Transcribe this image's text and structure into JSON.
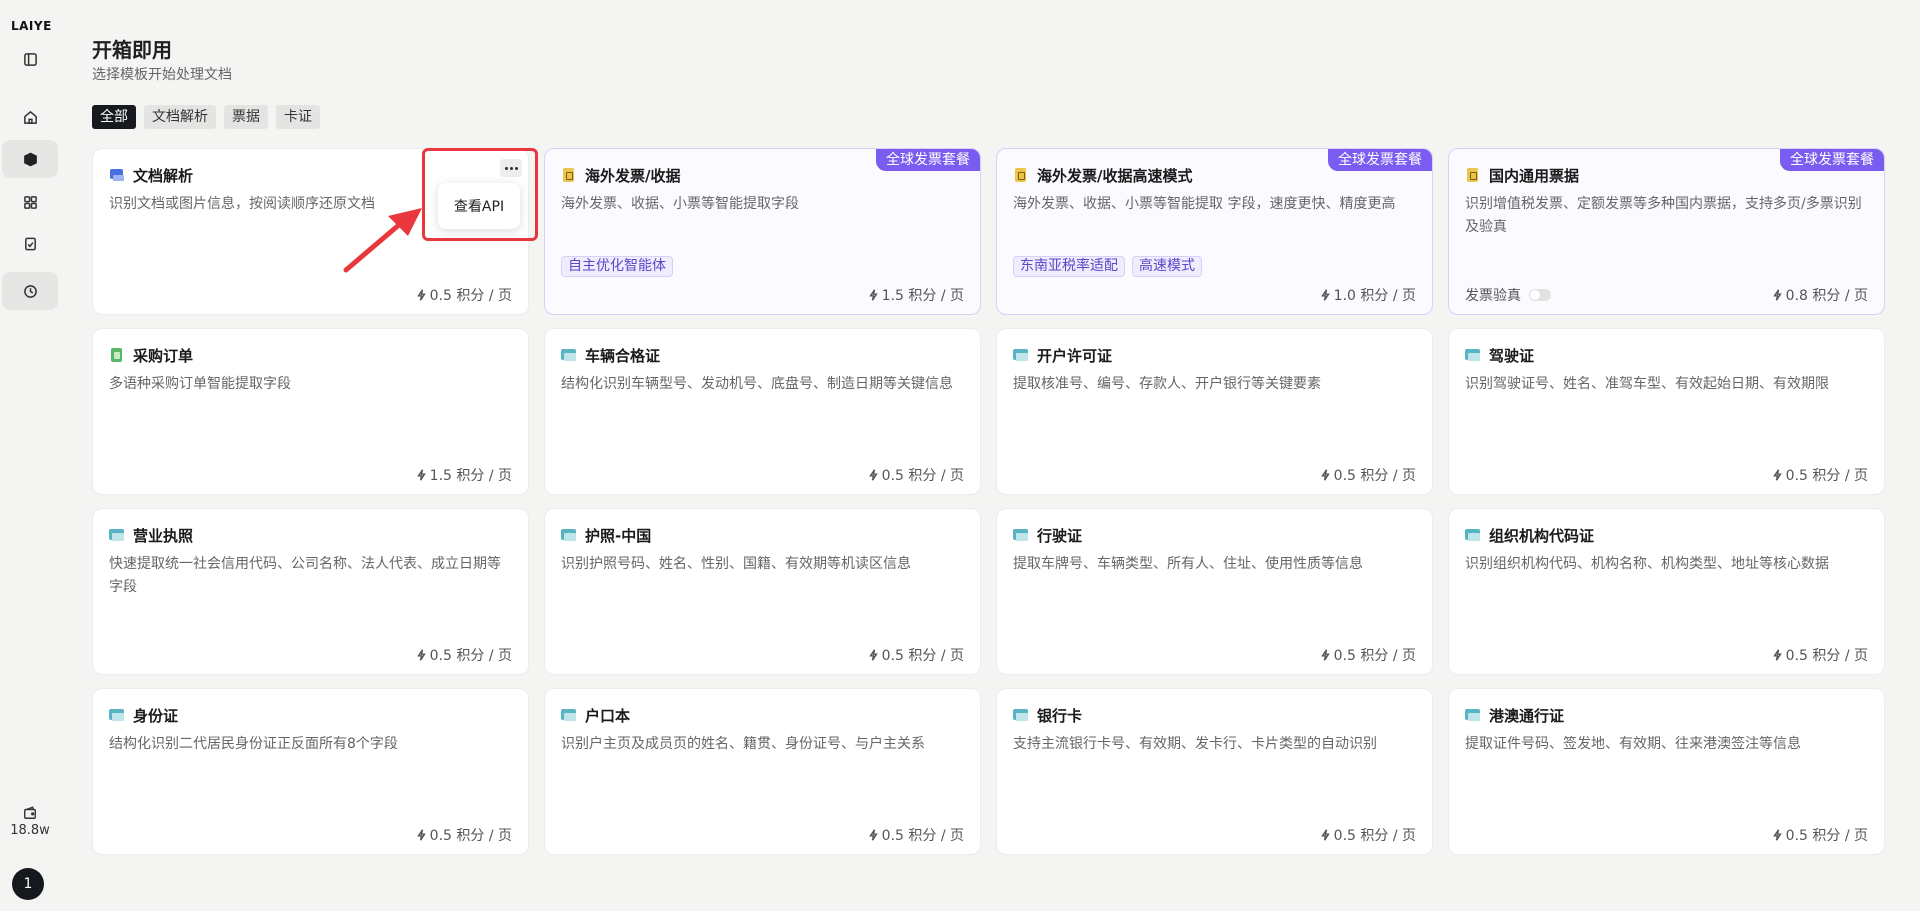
{
  "sidebar": {
    "logo": "LAIYE",
    "credits": "18.8w",
    "avatar": "1",
    "items": [
      {
        "name": "toggle-sidebar-icon"
      },
      {
        "name": "home-icon"
      },
      {
        "name": "box-icon"
      },
      {
        "name": "apps-icon"
      },
      {
        "name": "clipboard-check-icon"
      },
      {
        "name": "clock-icon"
      }
    ]
  },
  "header": {
    "title": "开箱即用",
    "subtitle": "选择模板开始处理文档"
  },
  "filters": [
    "全部",
    "文档解析",
    "票据",
    "卡证"
  ],
  "popup": {
    "label": "查看API"
  },
  "cards": [
    {
      "title": "文档解析",
      "desc": "识别文档或图片信息，按阅读顺序还原文档",
      "price": "0.5 积分 / 页",
      "icon": "doc"
    },
    {
      "title": "海外发票/收据",
      "desc": "海外发票、收据、小票等智能提取字段",
      "price": "1.5 积分 / 页",
      "icon": "inv",
      "badge": "全球发票套餐",
      "tags": [
        "自主优化智能体"
      ]
    },
    {
      "title": "海外发票/收据高速模式",
      "desc": "海外发票、收据、小票等智能提取 字段，速度更快、精度更高",
      "price": "1.0 积分 / 页",
      "icon": "inv",
      "badge": "全球发票套餐",
      "tags": [
        "东南亚税率适配",
        "高速模式"
      ]
    },
    {
      "title": "国内通用票据",
      "desc": "识别增值税发票、定额发票等多种国内票据，支持多页/多票识别及验真",
      "price": "0.8 积分 / 页",
      "icon": "inv",
      "badge": "全球发票套餐",
      "toggle": "发票验真"
    },
    {
      "title": "采购订单",
      "desc": "多语种采购订单智能提取字段",
      "price": "1.5 积分 / 页",
      "icon": "po"
    },
    {
      "title": "车辆合格证",
      "desc": "结构化识别车辆型号、发动机号、底盘号、制造日期等关键信息",
      "price": "0.5 积分 / 页",
      "icon": "card"
    },
    {
      "title": "开户许可证",
      "desc": "提取核准号、编号、存款人、开户银行等关键要素",
      "price": "0.5 积分 / 页",
      "icon": "card"
    },
    {
      "title": "驾驶证",
      "desc": "识别驾驶证号、姓名、准驾车型、有效起始日期、有效期限",
      "price": "0.5 积分 / 页",
      "icon": "card"
    },
    {
      "title": "营业执照",
      "desc": "快速提取统一社会信用代码、公司名称、法人代表、成立日期等字段",
      "price": "0.5 积分 / 页",
      "icon": "card"
    },
    {
      "title": "护照-中国",
      "desc": "识别护照号码、姓名、性别、国籍、有效期等机读区信息",
      "price": "0.5 积分 / 页",
      "icon": "card"
    },
    {
      "title": "行驶证",
      "desc": "提取车牌号、车辆类型、所有人、住址、使用性质等信息",
      "price": "0.5 积分 / 页",
      "icon": "card"
    },
    {
      "title": "组织机构代码证",
      "desc": "识别组织机构代码、机构名称、机构类型、地址等核心数据",
      "price": "0.5 积分 / 页",
      "icon": "card"
    },
    {
      "title": "身份证",
      "desc": "结构化识别二代居民身份证正反面所有8个字段",
      "price": "0.5 积分 / 页",
      "icon": "card"
    },
    {
      "title": "户口本",
      "desc": "识别户主页及成员页的姓名、籍贯、身份证号、与户主关系",
      "price": "0.5 积分 / 页",
      "icon": "card"
    },
    {
      "title": "银行卡",
      "desc": "支持主流银行卡号、有效期、发卡行、卡片类型的自动识别",
      "price": "0.5 积分 / 页",
      "icon": "card"
    },
    {
      "title": "港澳通行证",
      "desc": "提取证件号码、签发地、有效期、往来港澳签注等信息",
      "price": "0.5 积分 / 页",
      "icon": "card"
    }
  ],
  "colors": {
    "accent": "#7b5cf0",
    "highlight": "#e8383d",
    "dark": "#16191d"
  }
}
